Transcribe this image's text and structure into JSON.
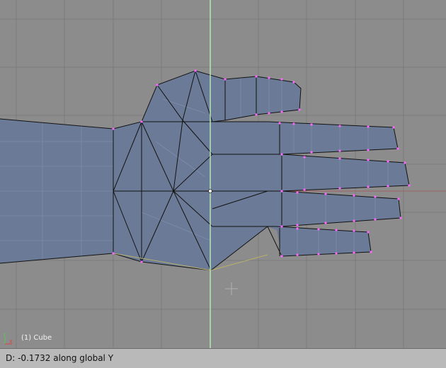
{
  "viewport": {
    "object_label": "(1) Cube",
    "axis_y_label": "Y",
    "axis_x_label": "X",
    "grid_color": "#7a7a7a",
    "mesh_fill": "#6b7a96",
    "mesh_wire": "#1a1a1a",
    "vertex_color": "#ff66ff",
    "axis_line_color": "#b5e6b5"
  },
  "statusbar": {
    "text": "D: -0.1732 along global Y"
  }
}
